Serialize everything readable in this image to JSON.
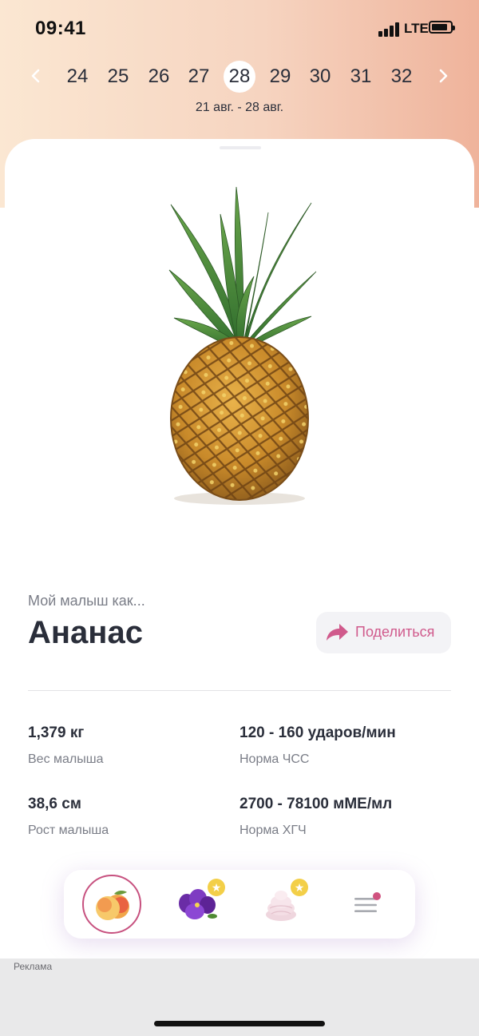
{
  "status_bar": {
    "time": "09:41",
    "network": "LTE",
    "icons": [
      "signal-icon",
      "battery-icon"
    ]
  },
  "weeks": {
    "items": [
      "24",
      "25",
      "26",
      "27",
      "28",
      "29",
      "30",
      "31",
      "32"
    ],
    "selected": "28",
    "date_range": "21 авг. - 28 авг."
  },
  "fruit": {
    "caption": "Мой малыш как...",
    "name": "Ананас",
    "image_icon": "pineapple-image"
  },
  "share": {
    "label": "Поделиться",
    "icon": "share-arrow-icon"
  },
  "stats": {
    "weight": {
      "value": "1,379 кг",
      "label": "Вес малыша"
    },
    "heart_rate": {
      "value": "120 - 160 ударов/мин",
      "label": "Норма ЧСС"
    },
    "height": {
      "value": "38,6 см",
      "label": "Рост малыша"
    },
    "hcg": {
      "value": "2700 - 78100 мМЕ/мл",
      "label": "Норма ХГЧ"
    }
  },
  "bottom_nav": {
    "items": [
      "peach-icon",
      "violet-flower-icon",
      "marshmallow-icon",
      "menu-icon"
    ],
    "badges": [
      "star-badge",
      "star-badge",
      "notification-dot"
    ]
  },
  "ad": {
    "label": "Реклама"
  },
  "colors": {
    "accent": "#c7517f",
    "share_text": "#d05a8c",
    "text_dark": "#2a2e3a",
    "text_muted": "#7a7d87",
    "badge_star": "#f3cf48"
  }
}
